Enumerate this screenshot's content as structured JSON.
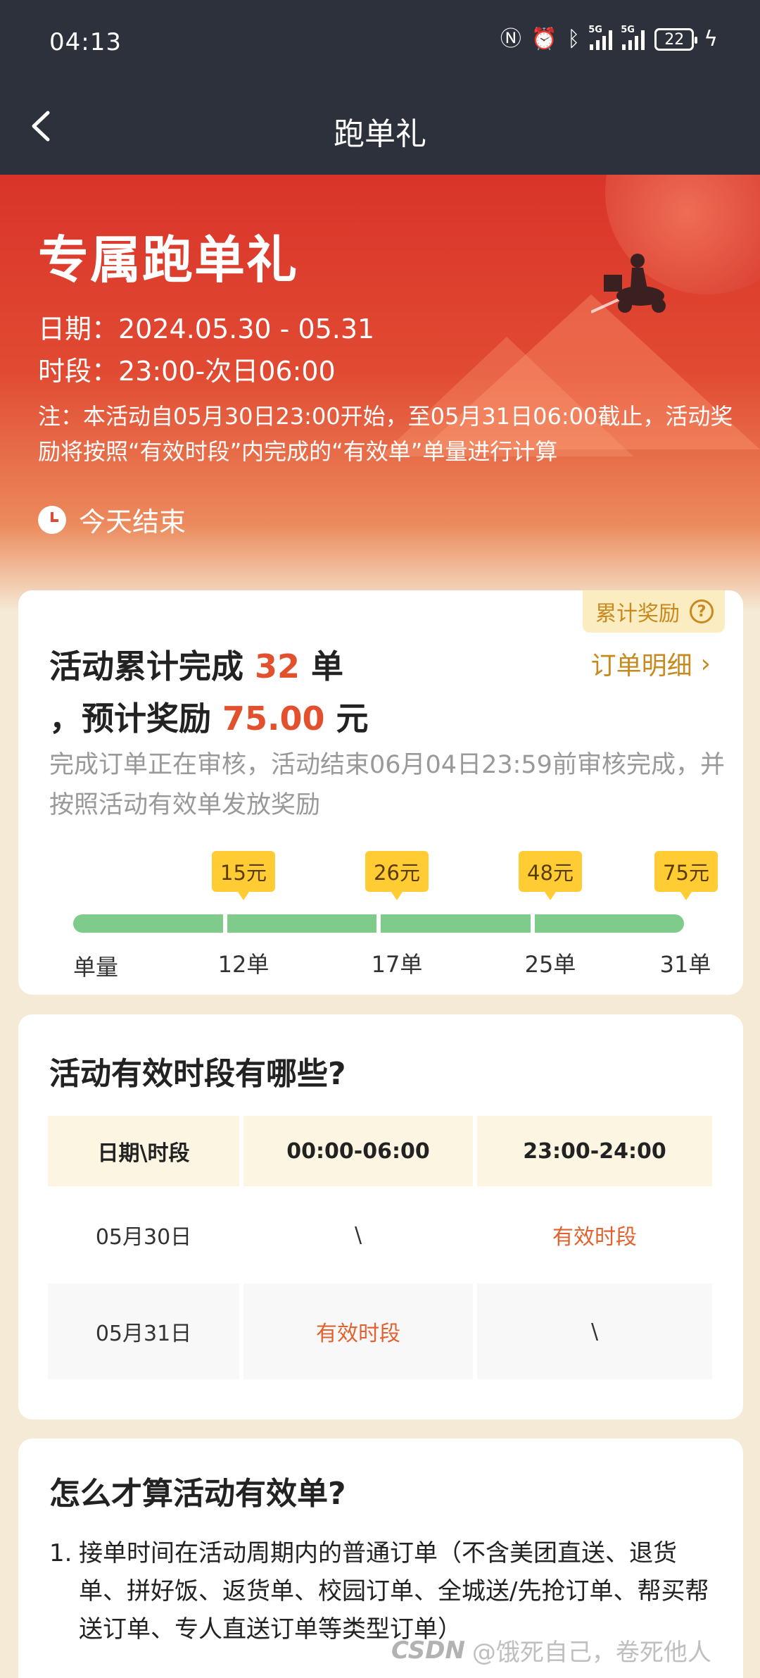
{
  "status_bar": {
    "time": "04:13",
    "signal1_tag": "5G",
    "signal2_tag": "5G",
    "battery": "22"
  },
  "nav": {
    "title": "跑单礼"
  },
  "hero": {
    "headline": "专属跑单礼",
    "date_line": "日期：2024.05.30 - 05.31",
    "time_line": "时段：23:00-次日06:00",
    "note": "注：本活动自05月30日23:00开始，至05月31日06:00截止，活动奖励将按照“有效时段”内完成的“有效单”单量进行计算",
    "ends": "今天结束"
  },
  "summary": {
    "reward_tag": "累计奖励",
    "line1_prefix": "活动累计完成 ",
    "orders_count": "32",
    "line1_suffix": " 单",
    "line2_prefix": "，预计奖励 ",
    "reward_amount": "75.00",
    "line2_suffix": " 元",
    "detail_link": "订单明细",
    "description": "完成订单正在审核，活动结束06月04日23:59前审核完成，并按照活动有效单发放奖励",
    "unit_label": "单量",
    "tiers": [
      {
        "reward": "15元",
        "orders": "12单"
      },
      {
        "reward": "26元",
        "orders": "17单"
      },
      {
        "reward": "48元",
        "orders": "25单"
      },
      {
        "reward": "75元",
        "orders": "31单"
      }
    ]
  },
  "periods": {
    "title": "活动有效时段有哪些?",
    "headers": [
      "日期\\时段",
      "00:00-06:00",
      "23:00-24:00"
    ],
    "rows": [
      [
        "05月30日",
        "\\",
        "有效时段"
      ],
      [
        "05月31日",
        "有效时段",
        "\\"
      ]
    ]
  },
  "rules": {
    "title": "怎么才算活动有效单?",
    "items": [
      {
        "num": "1.",
        "text": "接单时间在活动周期内的普通订单（不含美团直送、退货单、拼好饭、返货单、校园订单、全城送/先抢订单、帮买帮送订单、专人直送订单等类型订单）"
      }
    ]
  },
  "watermark": {
    "logo": "CSDN",
    "text": "@饿死自己，卷死他人"
  },
  "colors": {
    "bar_bg": "#2c313b",
    "accent": "#e2502e",
    "gold": "#c88a1e",
    "progress": "#7ecb8b",
    "bubble": "#ffcc33"
  }
}
